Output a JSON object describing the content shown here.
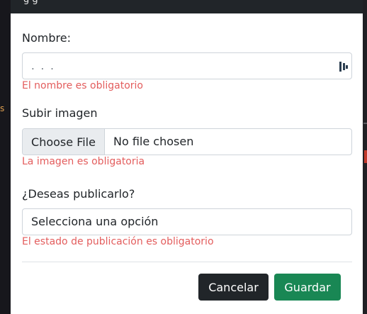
{
  "form": {
    "name": {
      "label": "Nombre:",
      "placeholder": ". . .",
      "error": "El nombre es obligatorio"
    },
    "image": {
      "label": "Subir imagen",
      "button_label": "Choose File",
      "status": "No file chosen",
      "error": "La imagen es obligatoria"
    },
    "publish": {
      "label": "¿Deseas publicarlo?",
      "selected": "Selecciona una opción",
      "error": "El estado de publicación es obligatorio"
    }
  },
  "footer": {
    "cancel_label": "Cancelar",
    "save_label": "Guardar"
  },
  "colors": {
    "error": "#e35d5d",
    "header": "#212529",
    "cancel_button": "#212529",
    "save_button": "#198754"
  },
  "icons": {
    "password_manager": "password-manager-icon"
  }
}
